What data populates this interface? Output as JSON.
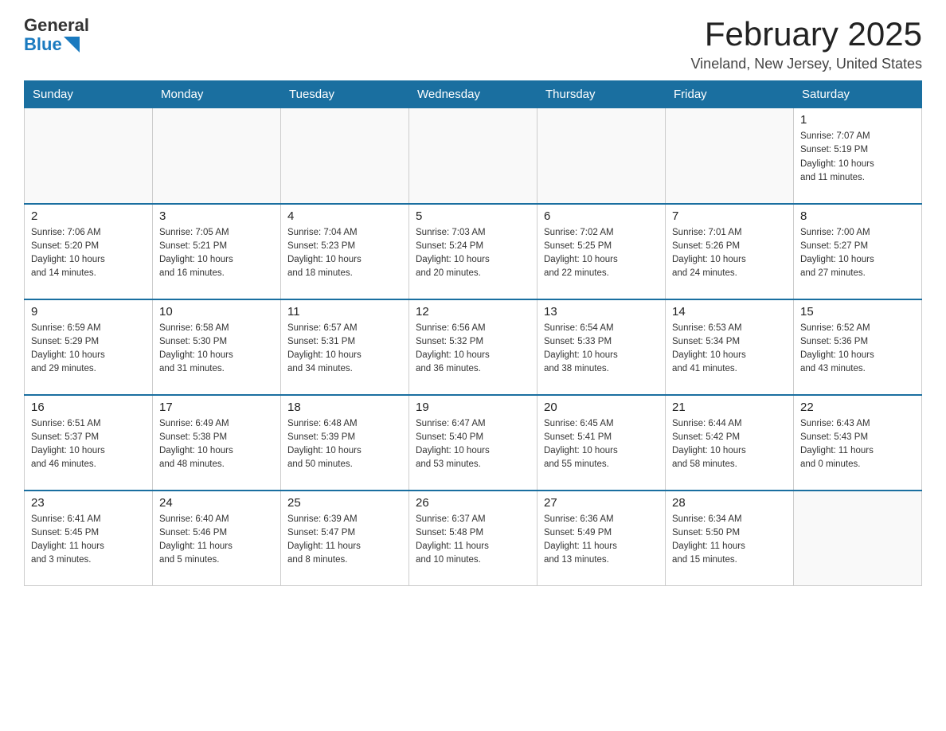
{
  "header": {
    "logo_general": "General",
    "logo_blue": "Blue",
    "title": "February 2025",
    "location": "Vineland, New Jersey, United States"
  },
  "days_of_week": [
    "Sunday",
    "Monday",
    "Tuesday",
    "Wednesday",
    "Thursday",
    "Friday",
    "Saturday"
  ],
  "weeks": [
    [
      {
        "day": "",
        "info": ""
      },
      {
        "day": "",
        "info": ""
      },
      {
        "day": "",
        "info": ""
      },
      {
        "day": "",
        "info": ""
      },
      {
        "day": "",
        "info": ""
      },
      {
        "day": "",
        "info": ""
      },
      {
        "day": "1",
        "info": "Sunrise: 7:07 AM\nSunset: 5:19 PM\nDaylight: 10 hours\nand 11 minutes."
      }
    ],
    [
      {
        "day": "2",
        "info": "Sunrise: 7:06 AM\nSunset: 5:20 PM\nDaylight: 10 hours\nand 14 minutes."
      },
      {
        "day": "3",
        "info": "Sunrise: 7:05 AM\nSunset: 5:21 PM\nDaylight: 10 hours\nand 16 minutes."
      },
      {
        "day": "4",
        "info": "Sunrise: 7:04 AM\nSunset: 5:23 PM\nDaylight: 10 hours\nand 18 minutes."
      },
      {
        "day": "5",
        "info": "Sunrise: 7:03 AM\nSunset: 5:24 PM\nDaylight: 10 hours\nand 20 minutes."
      },
      {
        "day": "6",
        "info": "Sunrise: 7:02 AM\nSunset: 5:25 PM\nDaylight: 10 hours\nand 22 minutes."
      },
      {
        "day": "7",
        "info": "Sunrise: 7:01 AM\nSunset: 5:26 PM\nDaylight: 10 hours\nand 24 minutes."
      },
      {
        "day": "8",
        "info": "Sunrise: 7:00 AM\nSunset: 5:27 PM\nDaylight: 10 hours\nand 27 minutes."
      }
    ],
    [
      {
        "day": "9",
        "info": "Sunrise: 6:59 AM\nSunset: 5:29 PM\nDaylight: 10 hours\nand 29 minutes."
      },
      {
        "day": "10",
        "info": "Sunrise: 6:58 AM\nSunset: 5:30 PM\nDaylight: 10 hours\nand 31 minutes."
      },
      {
        "day": "11",
        "info": "Sunrise: 6:57 AM\nSunset: 5:31 PM\nDaylight: 10 hours\nand 34 minutes."
      },
      {
        "day": "12",
        "info": "Sunrise: 6:56 AM\nSunset: 5:32 PM\nDaylight: 10 hours\nand 36 minutes."
      },
      {
        "day": "13",
        "info": "Sunrise: 6:54 AM\nSunset: 5:33 PM\nDaylight: 10 hours\nand 38 minutes."
      },
      {
        "day": "14",
        "info": "Sunrise: 6:53 AM\nSunset: 5:34 PM\nDaylight: 10 hours\nand 41 minutes."
      },
      {
        "day": "15",
        "info": "Sunrise: 6:52 AM\nSunset: 5:36 PM\nDaylight: 10 hours\nand 43 minutes."
      }
    ],
    [
      {
        "day": "16",
        "info": "Sunrise: 6:51 AM\nSunset: 5:37 PM\nDaylight: 10 hours\nand 46 minutes."
      },
      {
        "day": "17",
        "info": "Sunrise: 6:49 AM\nSunset: 5:38 PM\nDaylight: 10 hours\nand 48 minutes."
      },
      {
        "day": "18",
        "info": "Sunrise: 6:48 AM\nSunset: 5:39 PM\nDaylight: 10 hours\nand 50 minutes."
      },
      {
        "day": "19",
        "info": "Sunrise: 6:47 AM\nSunset: 5:40 PM\nDaylight: 10 hours\nand 53 minutes."
      },
      {
        "day": "20",
        "info": "Sunrise: 6:45 AM\nSunset: 5:41 PM\nDaylight: 10 hours\nand 55 minutes."
      },
      {
        "day": "21",
        "info": "Sunrise: 6:44 AM\nSunset: 5:42 PM\nDaylight: 10 hours\nand 58 minutes."
      },
      {
        "day": "22",
        "info": "Sunrise: 6:43 AM\nSunset: 5:43 PM\nDaylight: 11 hours\nand 0 minutes."
      }
    ],
    [
      {
        "day": "23",
        "info": "Sunrise: 6:41 AM\nSunset: 5:45 PM\nDaylight: 11 hours\nand 3 minutes."
      },
      {
        "day": "24",
        "info": "Sunrise: 6:40 AM\nSunset: 5:46 PM\nDaylight: 11 hours\nand 5 minutes."
      },
      {
        "day": "25",
        "info": "Sunrise: 6:39 AM\nSunset: 5:47 PM\nDaylight: 11 hours\nand 8 minutes."
      },
      {
        "day": "26",
        "info": "Sunrise: 6:37 AM\nSunset: 5:48 PM\nDaylight: 11 hours\nand 10 minutes."
      },
      {
        "day": "27",
        "info": "Sunrise: 6:36 AM\nSunset: 5:49 PM\nDaylight: 11 hours\nand 13 minutes."
      },
      {
        "day": "28",
        "info": "Sunrise: 6:34 AM\nSunset: 5:50 PM\nDaylight: 11 hours\nand 15 minutes."
      },
      {
        "day": "",
        "info": ""
      }
    ]
  ]
}
